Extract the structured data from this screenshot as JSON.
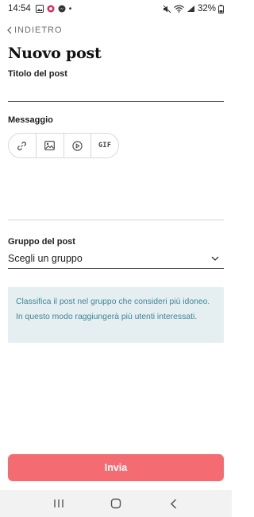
{
  "status_bar": {
    "time": "14:54",
    "dot": "•",
    "battery_percent": "32%"
  },
  "header": {
    "back_label": "INDIETRO",
    "title": "Nuovo post"
  },
  "form": {
    "title_label": "Titolo del post",
    "title_value": "",
    "message_label": "Messaggio",
    "message_value": "",
    "toolbar": {
      "items": [
        "link-icon",
        "image-icon",
        "video-play-icon",
        "gif-icon"
      ],
      "gif_label": "GIF"
    },
    "group_label": "Gruppo del post",
    "group_value": "Scegli un gruppo",
    "info_text": "Classifica il post nel gruppo che consideri più idoneo. In questo modo raggiungerà più utenti interessati."
  },
  "submit_label": "Invia",
  "colors": {
    "accent": "#f46c72",
    "info_bg": "#e5eff1",
    "info_text": "#3f8595"
  },
  "nav_bar": {
    "items": [
      "recent-apps-icon",
      "home-icon",
      "back-icon"
    ]
  }
}
